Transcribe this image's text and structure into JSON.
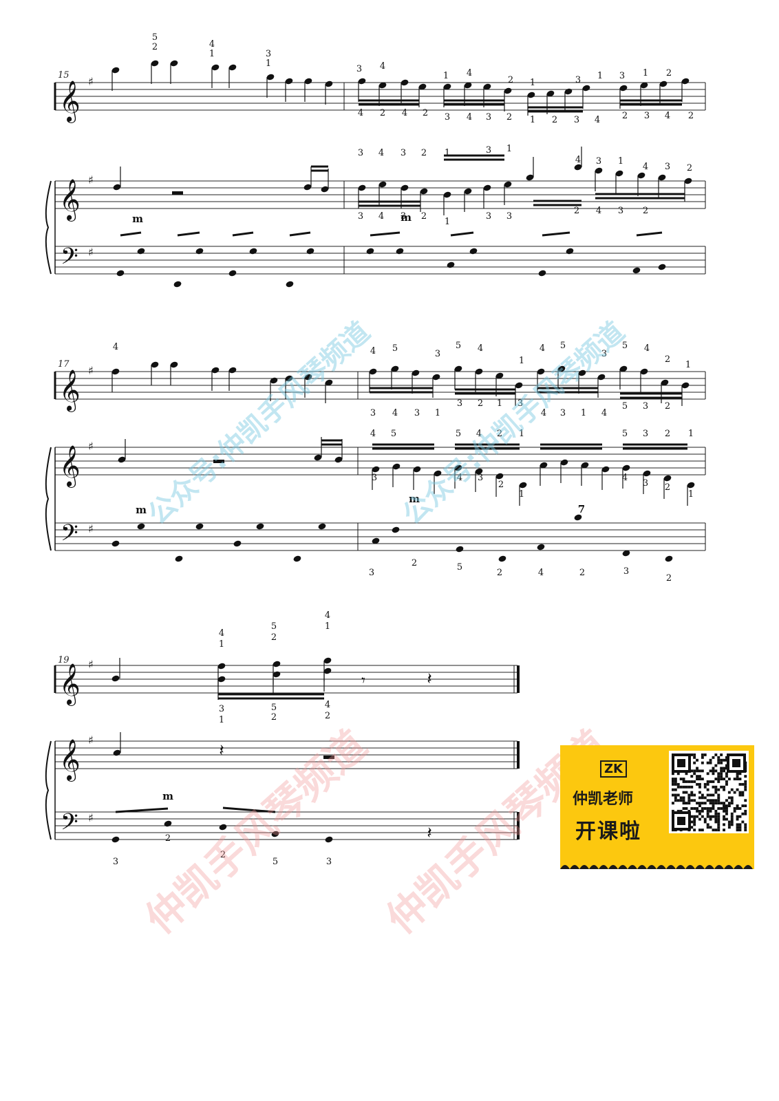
{
  "measure_numbers": [
    "15",
    "17",
    "19"
  ],
  "marks": {
    "m": "m",
    "m_tenor": "7"
  },
  "watermarks": {
    "blue": "公众号:仲凯手风琴频道",
    "red": "仲凯手风琴频道"
  },
  "banner": {
    "logo": "ZK",
    "line1": "仲凯老师",
    "line2": "开课啦",
    "background": "#fcc80f"
  },
  "fingerings": {
    "sys1_top": [
      "5",
      "2",
      "4",
      "1",
      "3",
      "1",
      "3",
      "4",
      "1",
      "4",
      "2",
      "1",
      "3",
      "1",
      "3",
      "1",
      "2",
      "4",
      "2",
      "4",
      "2",
      "3",
      "4",
      "3",
      "2",
      "1",
      "2",
      "3",
      "4",
      "2",
      "3",
      "4",
      "2"
    ],
    "sys2_top": [
      "4",
      "4",
      "5",
      "3",
      "5",
      "4",
      "1",
      "4",
      "5",
      "3",
      "5",
      "4",
      "2",
      "1",
      "3",
      "4",
      "3",
      "1",
      "3",
      "2",
      "1",
      "3",
      "4",
      "3",
      "1",
      "4",
      "5",
      "3",
      "2"
    ],
    "sys3_top": [
      "4",
      "1",
      "5",
      "2",
      "4",
      "1",
      "3",
      "1",
      "5",
      "2",
      "4",
      "2"
    ],
    "sys1_mid": [
      "3",
      "4",
      "3",
      "2",
      "1",
      "3",
      "1",
      "4",
      "3",
      "1",
      "4",
      "3",
      "2",
      "3",
      "4",
      "3",
      "2",
      "1",
      "3",
      "3",
      "2",
      "4",
      "3",
      "2",
      "4"
    ],
    "sys2_mid": [
      "4",
      "5",
      "5",
      "4",
      "2",
      "1",
      "5",
      "3",
      "2",
      "1",
      "3",
      "4",
      "3",
      "2",
      "1",
      "4",
      "3",
      "2",
      "1"
    ],
    "sys2_bass": [
      "3",
      "2",
      "5",
      "2",
      "4",
      "2",
      "3",
      "2"
    ],
    "sys3_mid": [],
    "sys3_bass": [
      "2",
      "3",
      "2",
      "5",
      "3"
    ]
  }
}
